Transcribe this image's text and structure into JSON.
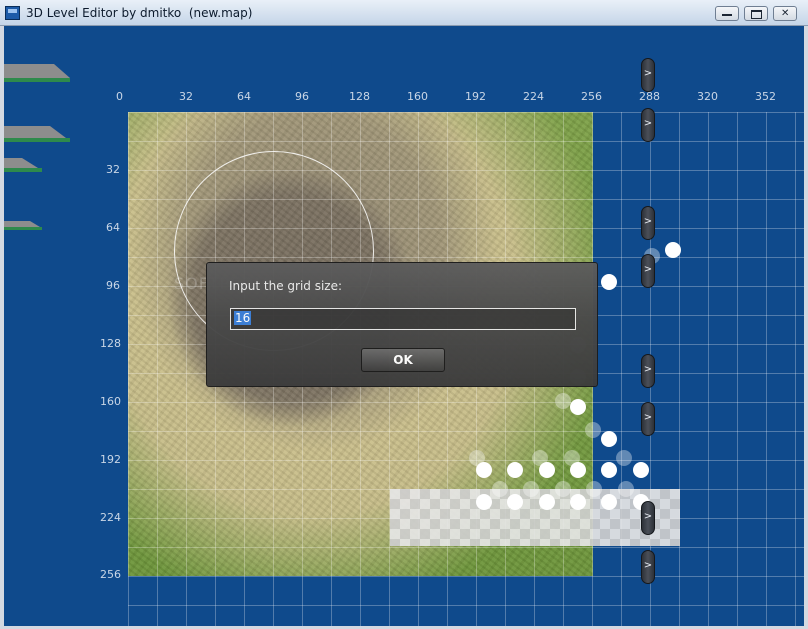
{
  "window": {
    "title": "3D Level Editor by dmitko  (new.map)",
    "controls": {
      "minimize_icon": "minimize-icon",
      "maximize_icon": "maximize-icon",
      "close_label": "✕"
    }
  },
  "ruler": {
    "x_labels": [
      "0",
      "32",
      "64",
      "96",
      "128",
      "160",
      "192",
      "224",
      "256",
      "288",
      "320",
      "352"
    ],
    "y_labels": [
      "32",
      "64",
      "96",
      "128",
      "160",
      "192",
      "224",
      "256"
    ]
  },
  "dialog": {
    "prompt": "Input the grid size:",
    "value": "16",
    "ok_label": "OK"
  },
  "watermark": "SOFTPEDIA",
  "handles": {
    "arrow": ">"
  },
  "colors": {
    "canvas_bg": "#0f4a8c",
    "grid_line": "#ffffff",
    "dialog_bg": "#4a4a4a",
    "selection": "#3b7fd8"
  }
}
